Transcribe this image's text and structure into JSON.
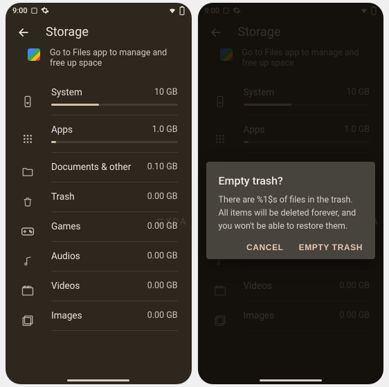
{
  "status": {
    "time": "9:00",
    "icons_left": [
      "recent-apps-icon",
      "gear-icon"
    ],
    "icons_right": [
      "wifi-icon",
      "battery-icon"
    ]
  },
  "header": {
    "title": "Storage"
  },
  "banner": {
    "text": "Go to Files app to manage and free up space"
  },
  "rows": [
    {
      "key": "system",
      "label": "System",
      "size": "10 GB",
      "fill": 38,
      "icon": "device-icon"
    },
    {
      "key": "apps",
      "label": "Apps",
      "size": "1.0 GB",
      "fill": 4,
      "icon": "apps-icon"
    },
    {
      "key": "docs",
      "label": "Documents & other",
      "size": "0.10 GB",
      "fill": 0,
      "icon": "folder-icon"
    },
    {
      "key": "trash",
      "label": "Trash",
      "size": "0.00 GB",
      "fill": 0,
      "icon": "trash-icon"
    },
    {
      "key": "games",
      "label": "Games",
      "size": "0.00 GB",
      "fill": 0,
      "icon": "gamepad-icon"
    },
    {
      "key": "audios",
      "label": "Audios",
      "size": "0.00 GB",
      "fill": 0,
      "icon": "music-icon"
    },
    {
      "key": "videos",
      "label": "Videos",
      "size": "0.00 GB",
      "fill": 0,
      "icon": "video-icon"
    },
    {
      "key": "images",
      "label": "Images",
      "size": "0.00 GB",
      "fill": 0,
      "icon": "images-icon"
    }
  ],
  "dialog": {
    "title": "Empty trash?",
    "body": "There are %1$s of files in the trash. All items will be deleted forever, and you won't be able to restore them.",
    "cancel": "CANCEL",
    "confirm": "EMPTY TRASH"
  },
  "watermark": "⊑XDA"
}
